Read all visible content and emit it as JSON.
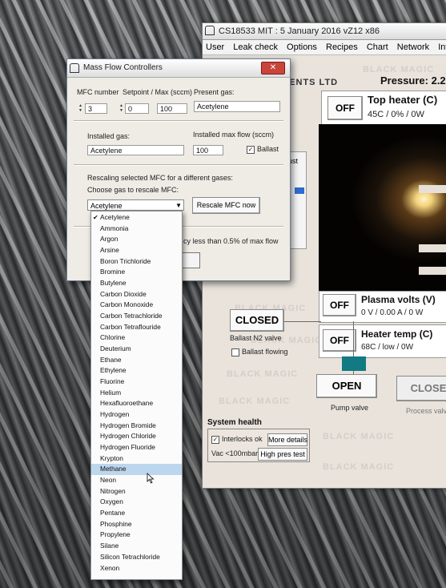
{
  "main_window": {
    "title": "CS18533 MIT : 5 January 2016 vZ12 x86",
    "menu": [
      "User",
      "Leak check",
      "Options",
      "Recipes",
      "Chart",
      "Network",
      "Interfa"
    ],
    "header_left": "MENTS LTD",
    "pressure_label": "Pressure: 2.2",
    "watermark": "BLACK MAGIC",
    "top_heater": {
      "button": "OFF",
      "title": "Top heater (C)",
      "status": "45C / 0% / 0W"
    },
    "plasma_volts": {
      "button": "OFF",
      "title": "Plasma volts (V)",
      "status": "0 V / 0.00 A / 0 W"
    },
    "heater_temp": {
      "button": "OFF",
      "title": "Heater temp (C)",
      "status": "68C / low / 0W"
    },
    "ballast_valve": {
      "button": "CLOSED",
      "label": "Ballast N2 valve",
      "checkbox_label": "Ballast flowing"
    },
    "pump_valve": {
      "button": "OPEN",
      "label": "Pump valve"
    },
    "process_valve": {
      "button": "CLOSE",
      "label": "Process valv"
    },
    "system_health": {
      "title": "System health",
      "interlocks_label": "Interlocks ok",
      "more_details": "More details",
      "vac_label": "Vac <100mbar",
      "high_pres_test": "High pres test"
    },
    "side_label": "ust"
  },
  "mfc_dialog": {
    "title": "Mass Flow Controllers",
    "close_glyph": "✕",
    "mfc_number_label": "MFC number",
    "mfc_number_value": "3",
    "setpoint_label": "Setpoint / Max (sccm)",
    "setpoint_value": "0",
    "max_value": "100",
    "present_gas_label": "Present gas:",
    "present_gas_value": "Acetylene",
    "installed_gas_label": "Installed gas:",
    "installed_gas_value": "Acetylene",
    "installed_max_label": "Installed max flow (sccm)",
    "installed_max_value": "100",
    "ballast_label": "Ballast",
    "rescale_heading": "Rescaling selected MFC for a different gases:",
    "choose_gas_label": "Choose gas to rescale MFC:",
    "combo_value": "Acetylene",
    "rescale_button": "Rescale MFC now",
    "note_text": "cy less than 0.5% of max flow"
  },
  "gas_dropdown": {
    "checked_item": "Acetylene",
    "highlighted_item": "Methane",
    "items": [
      "Acetylene",
      "Ammonia",
      "Argon",
      "Arsine",
      "Boron Trichloride",
      "Bromine",
      "Butylene",
      "Carbon Dioxide",
      "Carbon Monoxide",
      "Carbon Tetrachloride",
      "Carbon Tetraflouride",
      "Chlorine",
      "Deuterium",
      "Ethane",
      "Ethylene",
      "Fluorine",
      "Helium",
      "Hexafluoroethane",
      "Hydrogen",
      "Hydrogen Bromide",
      "Hydrogen Chloride",
      "Hydrogen Fluoride",
      "Krypton",
      "Methane",
      "Neon",
      "Nitrogen",
      "Oxygen",
      "Pentane",
      "Phosphine",
      "Propylene",
      "Silane",
      "Silicon Tetrachloride",
      "Xenon"
    ]
  }
}
